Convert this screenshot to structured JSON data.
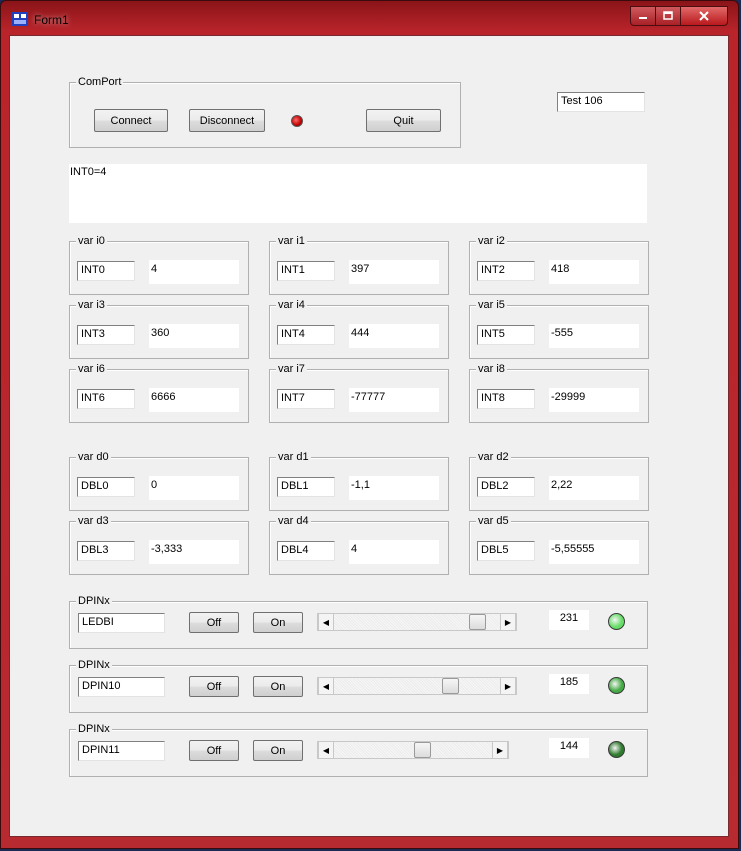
{
  "window": {
    "title": "Form1"
  },
  "comport": {
    "caption": "ComPort",
    "connect_label": "Connect",
    "disconnect_label": "Disconnect",
    "quit_label": "Quit",
    "status_led_color": "#cc0000"
  },
  "test_field_value": "Test 106",
  "memo_text": "INT0=4",
  "int_vars": [
    {
      "caption": "var i0",
      "name": "INT0",
      "value": "4"
    },
    {
      "caption": "var i1",
      "name": "INT1",
      "value": "397"
    },
    {
      "caption": "var i2",
      "name": "INT2",
      "value": "418"
    },
    {
      "caption": "var i3",
      "name": "INT3",
      "value": "360"
    },
    {
      "caption": "var i4",
      "name": "INT4",
      "value": "444"
    },
    {
      "caption": "var i5",
      "name": "INT5",
      "value": "-555"
    },
    {
      "caption": "var i6",
      "name": "INT6",
      "value": "6666"
    },
    {
      "caption": "var i7",
      "name": "INT7",
      "value": "-77777"
    },
    {
      "caption": "var i8",
      "name": "INT8",
      "value": "-29999"
    }
  ],
  "dbl_vars": [
    {
      "caption": "var d0",
      "name": "DBL0",
      "value": "0"
    },
    {
      "caption": "var d1",
      "name": "DBL1",
      "value": "-1,1"
    },
    {
      "caption": "var d2",
      "name": "DBL2",
      "value": "2,22"
    },
    {
      "caption": "var d3",
      "name": "DBL3",
      "value": "-3,333"
    },
    {
      "caption": "var d4",
      "name": "DBL4",
      "value": "4"
    },
    {
      "caption": "var d5",
      "name": "DBL5",
      "value": "-5,55555"
    }
  ],
  "pins": [
    {
      "caption": "DPINx",
      "name": "LEDBI",
      "off_label": "Off",
      "on_label": "On",
      "value": "231",
      "slider_fraction": 0.906,
      "led_color": "#66dd66"
    },
    {
      "caption": "DPINx",
      "name": "DPIN10",
      "off_label": "Off",
      "on_label": "On",
      "value": "185",
      "slider_fraction": 0.725,
      "led_color": "#44aa44"
    },
    {
      "caption": "DPINx",
      "name": "DPIN11",
      "off_label": "Off",
      "on_label": "On",
      "value": "144",
      "slider_fraction": 0.565,
      "led_color": "#2e7a2e"
    }
  ]
}
